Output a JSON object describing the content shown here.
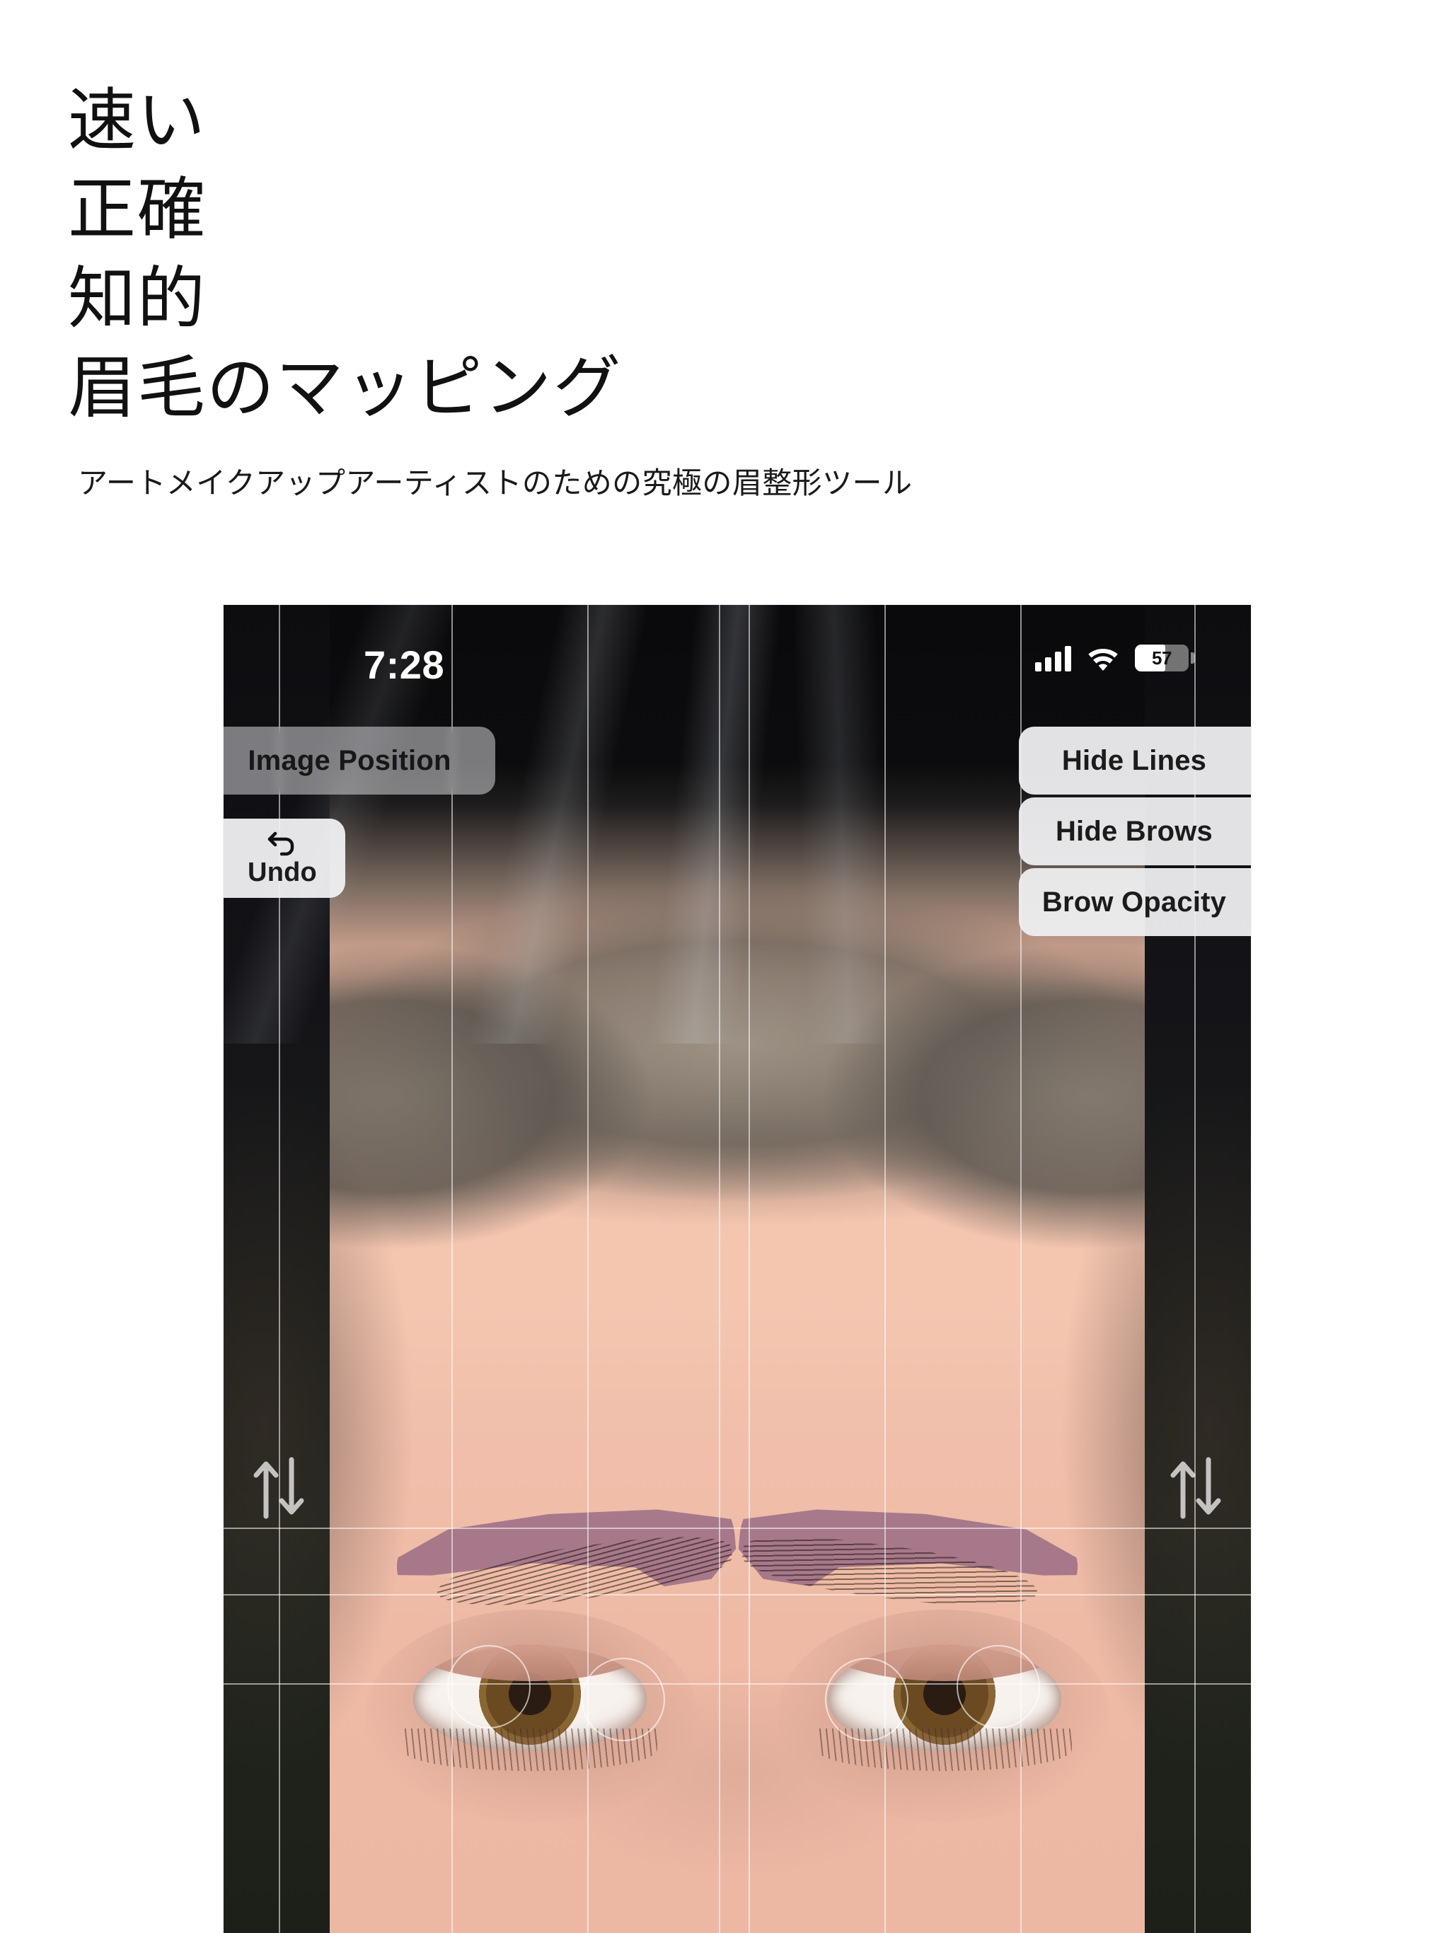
{
  "marketing": {
    "headline_lines": [
      "速い",
      "正確",
      "知的",
      "眉毛のマッピング"
    ],
    "subtitle": "アートメイクアップアーティストのための究極の眉整形ツール"
  },
  "phone": {
    "status_bar": {
      "time": "7:28",
      "cellular_icon": "signal-bars-icon",
      "wifi_icon": "wifi-icon",
      "battery_icon": "battery-icon",
      "battery_percent": "57"
    },
    "left_controls": [
      {
        "label": "Image Position",
        "name": "image-position-button"
      },
      {
        "label": "Undo",
        "name": "undo-button",
        "icon": "undo-arrow-icon"
      }
    ],
    "right_controls": [
      {
        "label": "Hide Lines",
        "name": "hide-lines-button"
      },
      {
        "label": "Hide Brows",
        "name": "hide-brows-button"
      },
      {
        "label": "Brow Opacity",
        "name": "brow-opacity-button"
      }
    ],
    "overlay": {
      "brow_color": "#7a60af",
      "guide_line_color": "#ffffff",
      "handle_icon": "up-down-arrows-icon"
    }
  },
  "colors": {
    "page_background": "#ffffff",
    "headline_text": "#111111",
    "subtitle_text": "#1a1a1a",
    "button_surface": "#eeeef0",
    "button_text": "#1b1b1b",
    "brow_overlay": "#7a60af"
  }
}
